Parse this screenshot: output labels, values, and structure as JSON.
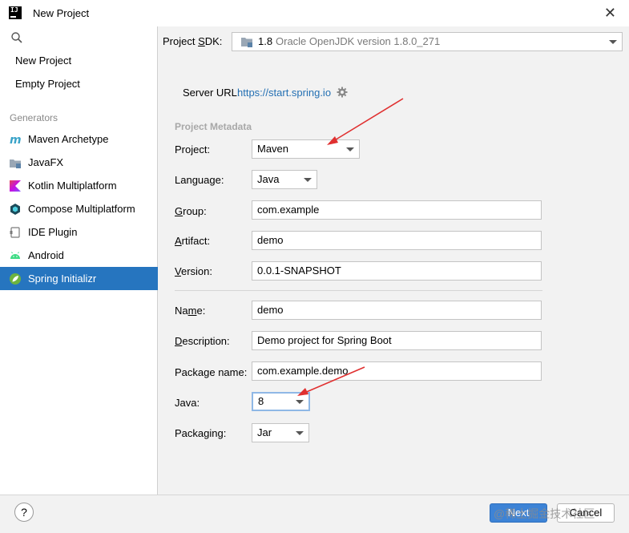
{
  "window": {
    "title": "New Project",
    "app_icon_text": "IJ"
  },
  "sidebar": {
    "top_items": [
      {
        "label": "New Project"
      },
      {
        "label": "Empty Project"
      }
    ],
    "generators_label": "Generators",
    "generators": [
      {
        "label": "Maven Archetype",
        "icon": "maven-icon"
      },
      {
        "label": "JavaFX",
        "icon": "javafx-folder-icon"
      },
      {
        "label": "Kotlin Multiplatform",
        "icon": "kotlin-icon"
      },
      {
        "label": "Compose Multiplatform",
        "icon": "compose-icon"
      },
      {
        "label": "IDE Plugin",
        "icon": "plugin-icon"
      },
      {
        "label": "Android",
        "icon": "android-icon"
      },
      {
        "label": "Spring Initializr",
        "icon": "spring-icon",
        "selected": true
      }
    ]
  },
  "main": {
    "sdk_label_pre": "Project ",
    "sdk_label_u": "S",
    "sdk_label_post": "DK:",
    "sdk_version": "1.8",
    "sdk_detail": "Oracle OpenJDK version 1.8.0_271",
    "server_url_label": "Server URL:",
    "server_url": "https://start.spring.io",
    "metadata_title": "Project Metadata",
    "project_label": "Project:",
    "project_value": "Maven",
    "language_label": "Language:",
    "language_value": "Java",
    "group_label_u": "G",
    "group_label_rest": "roup:",
    "group_value": "com.example",
    "artifact_label_u": "A",
    "artifact_label_rest": "rtifact:",
    "artifact_value": "demo",
    "version_label_u": "V",
    "version_label_rest": "ersion:",
    "version_value": "0.0.1-SNAPSHOT",
    "name_label_pre": "Na",
    "name_label_u": "m",
    "name_label_post": "e:",
    "name_value": "demo",
    "description_label_u": "D",
    "description_label_rest": "escription:",
    "description_value": "Demo project for Spring Boot",
    "package_label": "Package name:",
    "package_value": "com.example.demo",
    "java_label": "Java:",
    "java_value": "8",
    "packaging_label": "Packaging:",
    "packaging_value": "Jar"
  },
  "footer": {
    "help_label": "?",
    "next_label": "Next",
    "cancel_label": "Cancel",
    "watermark": "@稀土掘金技术社区"
  },
  "colors": {
    "selection": "#2675bf",
    "link": "#2470b3",
    "annotation_arrow": "#e03030"
  }
}
